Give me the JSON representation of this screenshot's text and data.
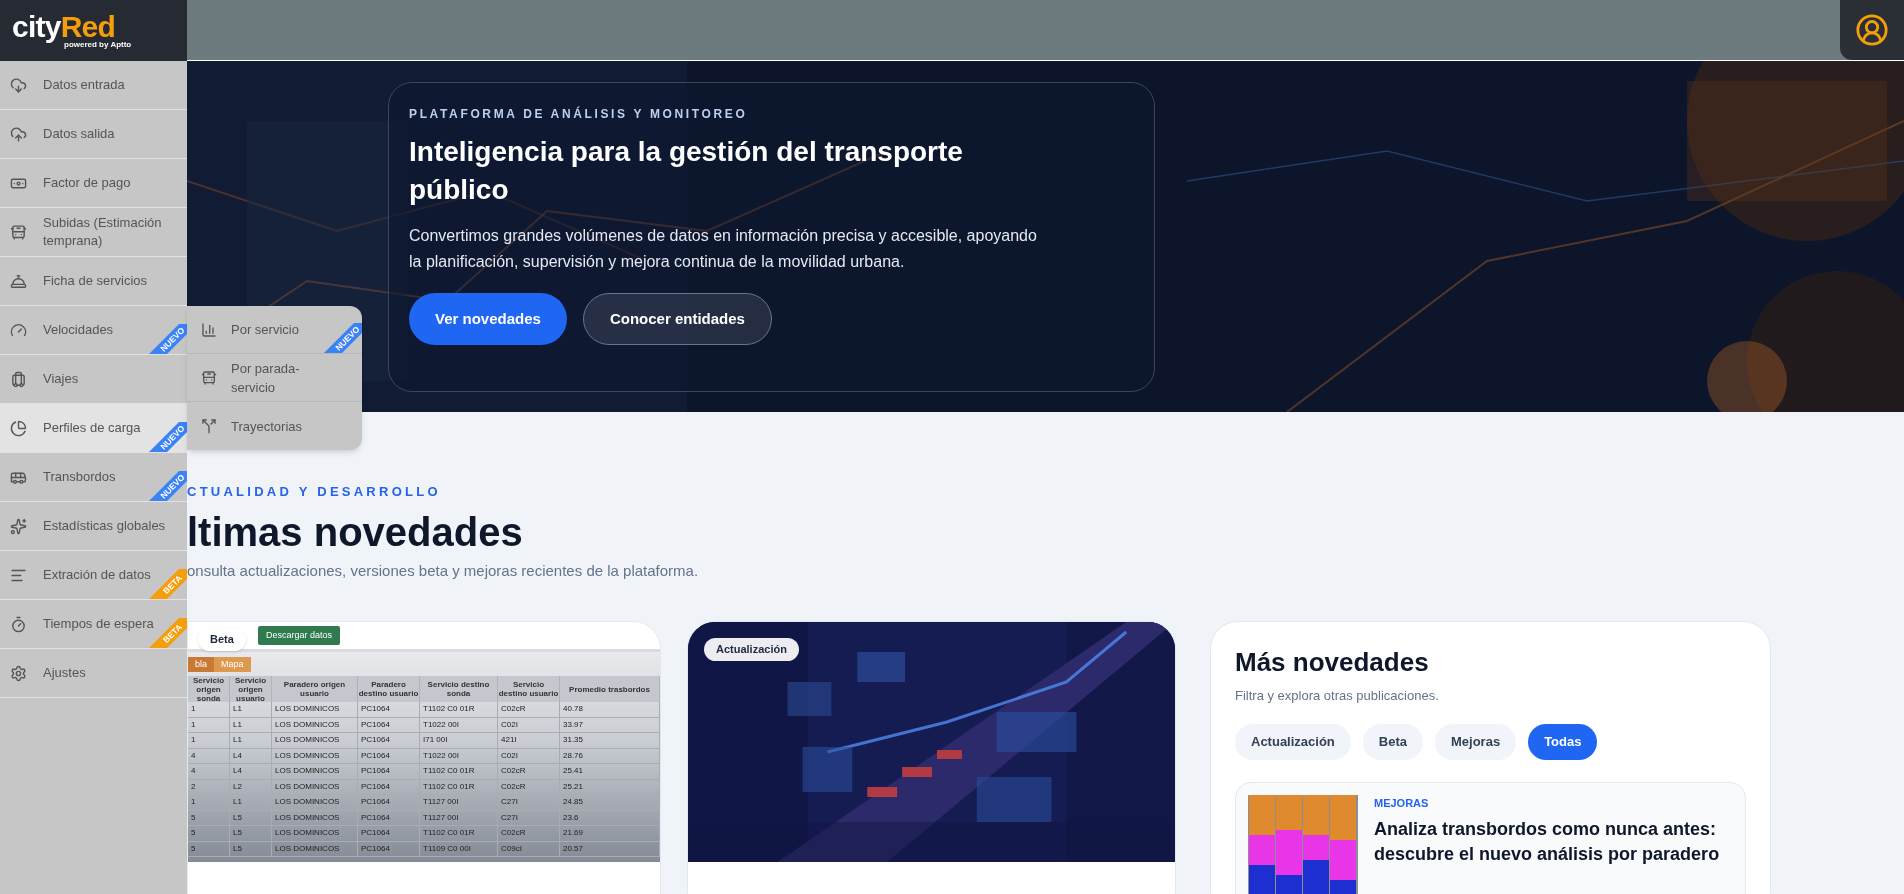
{
  "logo": {
    "brand_part_1": "city",
    "brand_part_2": "Red",
    "tagline": "powered by Aptto"
  },
  "sidebar": {
    "items": [
      {
        "label": "Datos entrada",
        "selected": false
      },
      {
        "label": "Datos salida",
        "selected": false
      },
      {
        "label": "Factor de pago",
        "selected": false
      },
      {
        "label": "Subidas (Estimación temprana)",
        "selected": false
      },
      {
        "label": "Ficha de servicios",
        "selected": false
      },
      {
        "label": "Velocidades",
        "selected": false,
        "badge": {
          "text": "NUEVO",
          "color": "#3b82f6"
        },
        "children": [
          {
            "label": "Por servicio",
            "badge": {
              "text": "NUEVO",
              "color": "#3b82f6"
            }
          },
          {
            "label": "Por parada-servicio"
          },
          {
            "label": "Trayectorias"
          }
        ]
      },
      {
        "label": "Viajes",
        "selected": false
      },
      {
        "label": "Perfiles de carga",
        "selected": true,
        "badge": {
          "text": "NUEVO",
          "color": "#3b82f6"
        }
      },
      {
        "label": "Transbordos",
        "selected": false,
        "badge": {
          "text": "NUEVO",
          "color": "#3b82f6"
        }
      },
      {
        "label": "Estadísticas globales",
        "selected": false
      },
      {
        "label": "Extración de datos",
        "selected": false,
        "badge": {
          "text": "BETA",
          "color": "#f59e0b"
        }
      },
      {
        "label": "Tiempos de espera",
        "selected": false,
        "badge": {
          "text": "BETA",
          "color": "#f59e0b"
        }
      },
      {
        "label": "Ajustes",
        "selected": false
      }
    ]
  },
  "hero": {
    "eyebrow": "PLATAFORMA DE ANÁLISIS Y MONITOREO",
    "title": "Inteligencia para la gestión del transporte público",
    "description": "Convertimos grandes volúmenes de datos en información precisa y accesible, apoyando la planificación, supervisión y mejora continua de la movilidad urbana.",
    "buttons": [
      {
        "label": "Ver novedades",
        "kind": "primary"
      },
      {
        "label": "Conocer entidades",
        "kind": "secondary"
      }
    ]
  },
  "section": {
    "eyebrow": "CTUALIDAD Y DESARROLLO",
    "title": "ltimas novedades",
    "subtitle": "onsulta actualizaciones, versiones beta y mejoras recientes de la plataforma."
  },
  "cards": [
    {
      "kind": "table-screenshot",
      "badge": "Beta",
      "screenshot": {
        "button": "Descargar datos",
        "tabs": [
          {
            "label": "bla",
            "selected": true
          },
          {
            "label": "Mapa",
            "selected": false
          }
        ],
        "columns": [
          "Servicio origen sonda",
          "Servicio origen usuario",
          "Paradero origen usuario",
          "Paradero destino usuario",
          "Servicio destino sonda",
          "Servicio destino usuario",
          "Promedio trasbordos"
        ],
        "rows": [
          [
            "1",
            "L1",
            "LOS DOMINICOS",
            "PC1064",
            "T1102 C0 01R",
            "C02cR",
            "40.78"
          ],
          [
            "1",
            "L1",
            "LOS DOMINICOS",
            "PC1064",
            "T1022 00I",
            "C02I",
            "33.97"
          ],
          [
            "1",
            "L1",
            "LOS DOMINICOS",
            "PC1064",
            "I71 00I",
            "421I",
            "31.35"
          ],
          [
            "4",
            "L4",
            "LOS DOMINICOS",
            "PC1064",
            "T1022 00I",
            "C02I",
            "28.76"
          ],
          [
            "4",
            "L4",
            "LOS DOMINICOS",
            "PC1064",
            "T1102 C0 01R",
            "C02cR",
            "25.41"
          ],
          [
            "2",
            "L2",
            "LOS DOMINICOS",
            "PC1064",
            "T1102 C0 01R",
            "C02cR",
            "25.21"
          ],
          [
            "1",
            "L1",
            "LOS DOMINICOS",
            "PC1064",
            "T1127 00I",
            "C27I",
            "24.85"
          ],
          [
            "5",
            "L5",
            "LOS DOMINICOS",
            "PC1064",
            "T1127 00I",
            "C27I",
            "23.6"
          ],
          [
            "5",
            "L5",
            "LOS DOMINICOS",
            "PC1064",
            "T1102 C0 01R",
            "C02cR",
            "21.69"
          ],
          [
            "5",
            "L5",
            "LOS DOMINICOS",
            "PC1064",
            "T1109 C0 00I",
            "C09cI",
            "20.57"
          ]
        ]
      }
    },
    {
      "badge": "Actualización"
    }
  ],
  "more": {
    "title": "Más novedades",
    "subtitle": "Filtra y explora otras publicaciones.",
    "filters": [
      {
        "label": "Actualización",
        "selected": false
      },
      {
        "label": "Beta",
        "selected": false
      },
      {
        "label": "Mejoras",
        "selected": false
      },
      {
        "label": "Todas",
        "selected": true
      }
    ],
    "posts": [
      {
        "category": "MEJORAS",
        "title": "Analiza transbordos como nunca antes: descubre el nuevo análisis por paradero"
      }
    ]
  }
}
